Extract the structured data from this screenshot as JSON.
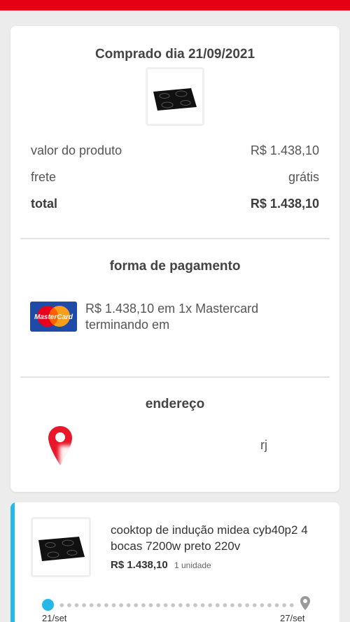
{
  "header": {
    "accent_color": "#e60014"
  },
  "summary": {
    "title": "Comprado dia 21/09/2021",
    "product_image_icon": "cooktop-image",
    "rows": [
      {
        "label": "valor do produto",
        "value": "R$ 1.438,10"
      },
      {
        "label": "frete",
        "value": "grátis"
      },
      {
        "label": "total",
        "value": "R$ 1.438,10"
      }
    ]
  },
  "payment": {
    "title": "forma de pagamento",
    "card_brand": "MasterCard",
    "line1": "R$ 1.438,10 em 1x Mastercard",
    "line2": "terminando em"
  },
  "address": {
    "title": "endereço",
    "icon": "location-pin-icon",
    "line1": "",
    "line2": "rj",
    "line3": ""
  },
  "order_item": {
    "name": "cooktop de indução midea cyb40p2 4 bocas 7200w preto 220v",
    "price": "R$ 1.438,10",
    "quantity": "1 unidade",
    "timeline": {
      "start": "21/set",
      "end": "27/set"
    },
    "accent_color": "#27b8ea"
  }
}
